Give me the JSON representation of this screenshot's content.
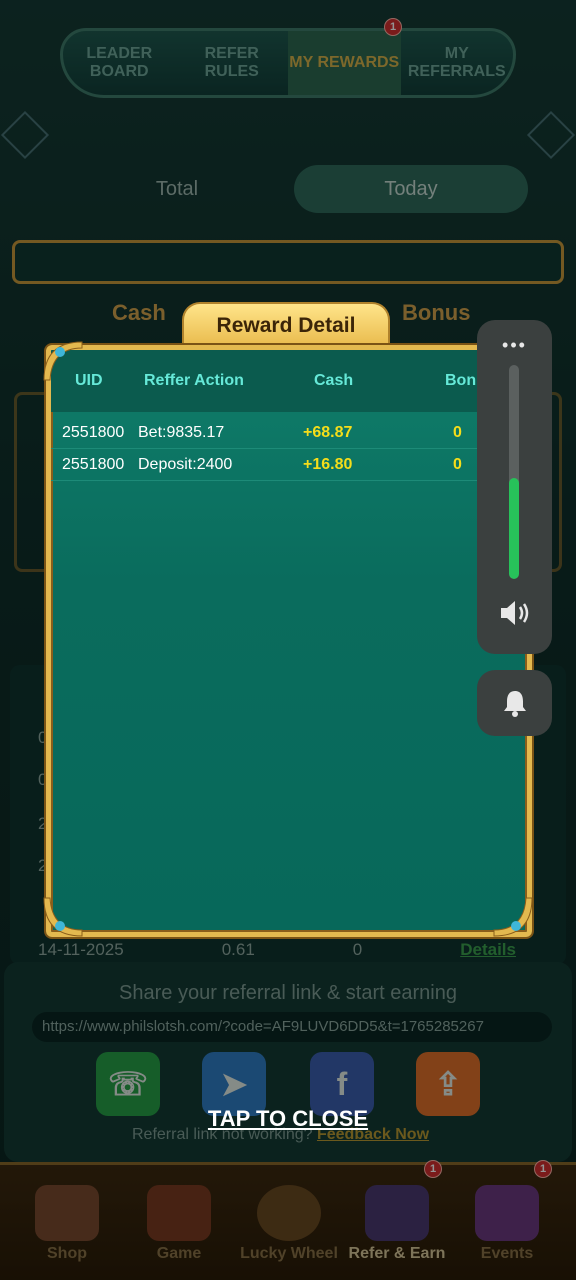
{
  "background": {
    "top_tabs": [
      {
        "label": "LEADER BOARD",
        "active": false
      },
      {
        "label": "REFER RULES",
        "active": false
      },
      {
        "label": "MY REWARDS",
        "active": true
      },
      {
        "label": "MY REFERRALS",
        "active": false
      }
    ],
    "top_tab_badge": "1",
    "segment": {
      "total": "Total",
      "today": "Today",
      "selected": "Today"
    },
    "labels": {
      "cash": "Cash",
      "bonus": "Bonus"
    },
    "history_rows": [
      {
        "date": "0",
        "value": "",
        "bonus": "",
        "action": ""
      },
      {
        "date": "0",
        "value": "",
        "bonus": "",
        "action": ""
      },
      {
        "date": "2",
        "value": "",
        "bonus": "",
        "action": ""
      },
      {
        "date": "2",
        "value": "",
        "bonus": "",
        "action": ""
      },
      {
        "date": "14-11-2025",
        "value": "0.61",
        "bonus": "0",
        "action": "Details"
      }
    ],
    "share": {
      "title": "Share your referral link & start earning",
      "link": "https://www.philslotsh.com/?code=AF9LUVD6DD5&t=1765285267",
      "not_working": "Referral link not working?",
      "feedback": "Feedback Now"
    },
    "bottom_nav": [
      {
        "label": "Shop",
        "active": false
      },
      {
        "label": "Game",
        "active": false
      },
      {
        "label": "Lucky Wheel",
        "active": false
      },
      {
        "label": "Refer & Earn",
        "active": true,
        "badge": "1"
      },
      {
        "label": "Events",
        "active": false,
        "badge": "1"
      }
    ]
  },
  "modal": {
    "title": "Reward Detail",
    "headers": {
      "uid": "UID",
      "action": "Reffer Action",
      "cash": "Cash",
      "bonus": "Bonus"
    },
    "rows": [
      {
        "uid": "2551800",
        "action": "Bet:9835.17",
        "cash": "+68.87",
        "bonus": "0"
      },
      {
        "uid": "2551800",
        "action": "Deposit:2400",
        "cash": "+16.80",
        "bonus": "0"
      }
    ],
    "tap_to_close": "TAP TO CLOSE"
  },
  "volume_overlay": {
    "more_icon": "more-dots-icon",
    "level": 0.47,
    "speaker_icon": "speaker-icon",
    "bell_icon": "bell-icon"
  },
  "colors": {
    "modal_bg": "#0a6c5d",
    "gold": "#e3b94f",
    "cash_value": "#f5dd1a",
    "volume_fill": "#27c25a"
  }
}
